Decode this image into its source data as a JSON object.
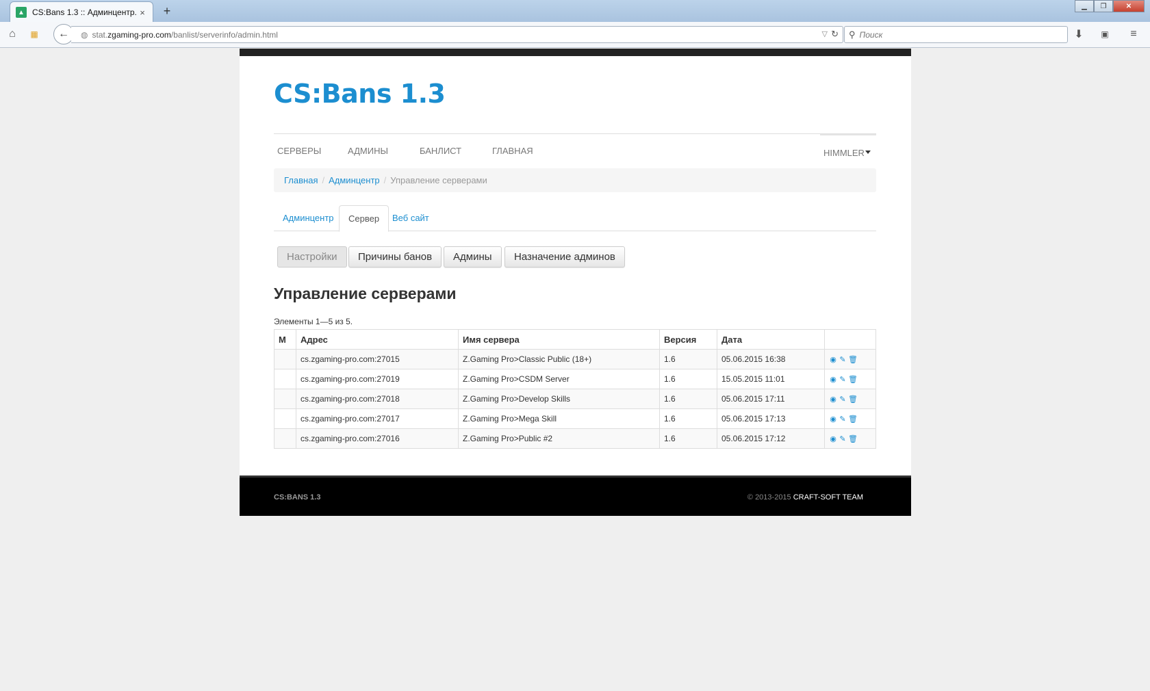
{
  "browser": {
    "tab_title": "CS:Bans 1.3 :: Админцентр...",
    "tab_close": "×",
    "new_tab": "+",
    "url_prefix": "stat.",
    "url_domain": "zgaming-pro.com",
    "url_path": "/banlist/serverinfo/admin.html",
    "search_placeholder": "Поиск"
  },
  "site": {
    "title": "CS:Bans 1.3",
    "menu": [
      "СЕРВЕРЫ",
      "АДМИНЫ",
      "БАНЛИСТ",
      "ГЛАВНАЯ"
    ],
    "user": "HIMMLER"
  },
  "breadcrumb": {
    "items": [
      "Главная",
      "Админцентр"
    ],
    "current": "Управление серверами"
  },
  "tabs": [
    "Админцентр",
    "Сервер",
    "Веб сайт"
  ],
  "buttons": [
    "Настройки",
    "Причины банов",
    "Админы",
    "Назначение админов"
  ],
  "heading": "Управление серверами",
  "summary": "Элементы 1—5 из 5.",
  "table": {
    "headers": [
      "М",
      "Адрес",
      "Имя сервера",
      "Версия",
      "Дата"
    ],
    "rows": [
      [
        "",
        "cs.zgaming-pro.com:27015",
        "Z.Gaming Pro>Classic Public (18+)",
        "1.6",
        "05.06.2015 16:38"
      ],
      [
        "",
        "cs.zgaming-pro.com:27019",
        "Z.Gaming Pro>CSDM Server",
        "1.6",
        "15.05.2015 11:01"
      ],
      [
        "",
        "cs.zgaming-pro.com:27018",
        "Z.Gaming Pro>Develop Skills",
        "1.6",
        "05.06.2015 17:11"
      ],
      [
        "",
        "cs.zgaming-pro.com:27017",
        "Z.Gaming Pro>Mega Skill",
        "1.6",
        "05.06.2015 17:13"
      ],
      [
        "",
        "cs.zgaming-pro.com:27016",
        "Z.Gaming Pro>Public #2",
        "1.6",
        "05.06.2015 17:12"
      ]
    ]
  },
  "footer": {
    "left": "CS:BANS 1.3",
    "copyright": "© 2013-2015",
    "team": "CRAFT-SOFT TEAM"
  },
  "colors": {
    "accent": "#1c8ed0",
    "footer_bg": "#000000",
    "top_stripe": "#222222"
  },
  "icons": {
    "row_actions": [
      "eye-icon",
      "pencil-icon",
      "trash-icon"
    ]
  }
}
